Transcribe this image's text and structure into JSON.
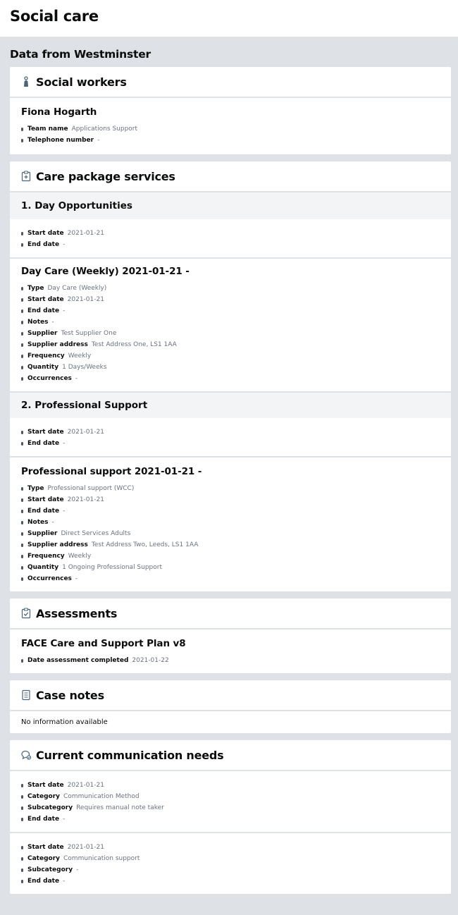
{
  "page_title": "Social care",
  "source_title": "Data from Westminster",
  "social_workers": {
    "title": "Social workers",
    "icon": "person-icon",
    "worker": {
      "name": "Fiona Hogarth",
      "props": [
        {
          "k": "Team name",
          "v": "Applications Support"
        },
        {
          "k": "Telephone number",
          "v": "-"
        }
      ]
    }
  },
  "care_package": {
    "title": "Care package services",
    "icon": "medical-clipboard-icon",
    "groups": [
      {
        "heading": "1. Day Opportunities",
        "props": [
          {
            "k": "Start date",
            "v": "2021-01-21"
          },
          {
            "k": "End date",
            "v": "-"
          }
        ],
        "service": {
          "title": "Day Care (Weekly) 2021-01-21 -",
          "props": [
            {
              "k": "Type",
              "v": "Day Care (Weekly)"
            },
            {
              "k": "Start date",
              "v": "2021-01-21"
            },
            {
              "k": "End date",
              "v": "-"
            },
            {
              "k": "Notes",
              "v": "-"
            },
            {
              "k": "Supplier",
              "v": "Test Supplier One"
            },
            {
              "k": "Supplier address",
              "v": "Test Address One, LS1 1AA"
            },
            {
              "k": "Frequency",
              "v": "Weekly"
            },
            {
              "k": "Quantity",
              "v": "1 Days/Weeks"
            },
            {
              "k": "Occurrences",
              "v": "-"
            }
          ]
        }
      },
      {
        "heading": "2. Professional Support",
        "props": [
          {
            "k": "Start date",
            "v": "2021-01-21"
          },
          {
            "k": "End date",
            "v": "-"
          }
        ],
        "service": {
          "title": "Professional support 2021-01-21 -",
          "props": [
            {
              "k": "Type",
              "v": "Professional support (WCC)"
            },
            {
              "k": "Start date",
              "v": "2021-01-21"
            },
            {
              "k": "End date",
              "v": "-"
            },
            {
              "k": "Notes",
              "v": "-"
            },
            {
              "k": "Supplier",
              "v": "Direct Services Adults"
            },
            {
              "k": "Supplier address",
              "v": "Test Address Two, Leeds, LS1 1AA"
            },
            {
              "k": "Frequency",
              "v": "Weekly"
            },
            {
              "k": "Quantity",
              "v": "1 Ongoing Professional Support"
            },
            {
              "k": "Occurrences",
              "v": "-"
            }
          ]
        }
      }
    ]
  },
  "assessments": {
    "title": "Assessments",
    "icon": "clipboard-check-icon",
    "item_title": "FACE Care and Support Plan v8",
    "props": [
      {
        "k": "Date assessment completed",
        "v": "2021-01-22"
      }
    ]
  },
  "case_notes": {
    "title": "Case notes",
    "icon": "document-icon",
    "empty_text": "No information available"
  },
  "communication_needs": {
    "title": "Current communication needs",
    "icon": "chat-icon",
    "entries": [
      {
        "props": [
          {
            "k": "Start date",
            "v": "2021-01-21"
          },
          {
            "k": "Category",
            "v": "Communication Method"
          },
          {
            "k": "Subcategory",
            "v": "Requires manual note taker"
          },
          {
            "k": "End date",
            "v": "-"
          }
        ]
      },
      {
        "props": [
          {
            "k": "Start date",
            "v": "2021-01-21"
          },
          {
            "k": "Category",
            "v": "Communication support"
          },
          {
            "k": "Subcategory",
            "v": "-"
          },
          {
            "k": "End date",
            "v": "-"
          }
        ]
      }
    ]
  }
}
